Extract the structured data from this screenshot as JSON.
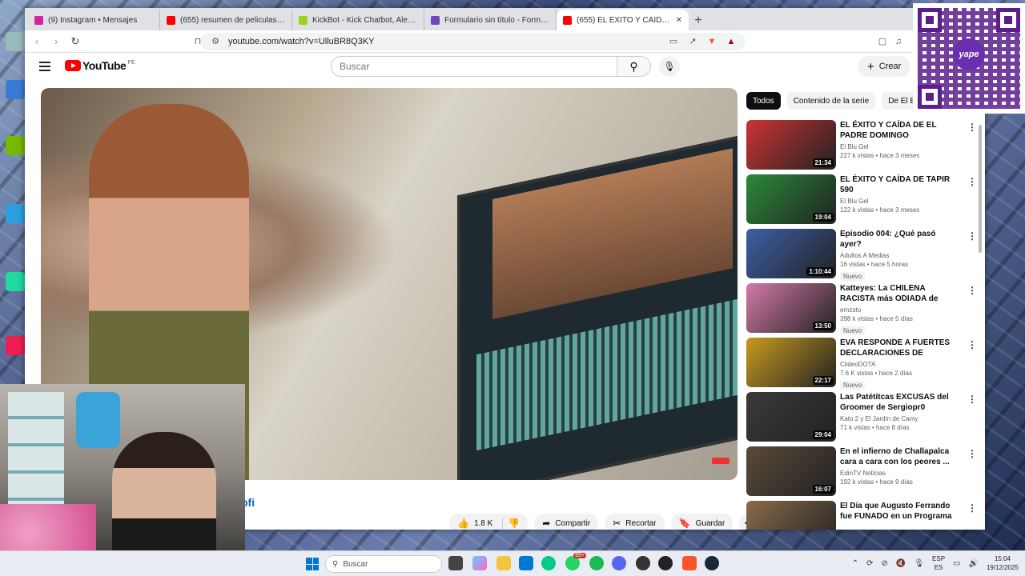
{
  "browser": {
    "tabs": [
      {
        "title": "(9) Instagram • Mensajes",
        "color": "#d6249f"
      },
      {
        "title": "(655) resumen de peliculas - YouTube",
        "color": "#ff0000"
      },
      {
        "title": "KickBot - Kick Chatbot, Alerts, TTS, O...",
        "color": "#9ad317"
      },
      {
        "title": "Formulario sin título - Formularios de...",
        "color": "#7248b9"
      },
      {
        "title": "(655) EL ÉXITO Y CAÍDA DE D...",
        "color": "#ff0000"
      }
    ],
    "url": "youtube.com/watch?v=UlluBR8Q3KY"
  },
  "youtube": {
    "logo_text": "YouTube",
    "country_code": "PE",
    "search_placeholder": "Buscar",
    "create_label": "Crear",
    "title_tail": "ofi",
    "actions": {
      "likes": "1.8 K",
      "share": "Compartir",
      "clip": "Recortar",
      "save": "Guardar"
    },
    "chips": [
      "Todos",
      "Contenido de la serie",
      "De El Blu G"
    ],
    "related": [
      {
        "title": "EL ÉXITO Y CAÍDA DE EL PADRE DOMINGO",
        "channel": "El Blu Gel",
        "meta": "227 k vistas • hace 3 meses",
        "duration": "21:34",
        "badge": ""
      },
      {
        "title": "EL ÉXITO Y CAÍDA DE TAPIR 590",
        "channel": "El Blu Gel",
        "meta": "122 k vistas • hace 3 meses",
        "duration": "19:04",
        "badge": ""
      },
      {
        "title": "Episodio 004: ¿Qué pasó ayer?",
        "channel": "Adultos A Medias",
        "meta": "16 vistas • hace 5 horas",
        "duration": "1:10:44",
        "badge": "Nuevo"
      },
      {
        "title": "Katteyes: La CHILENA RACISTA más ODIADA de TIKTOK",
        "channel": "ernzsto",
        "meta": "398 k vistas • hace 5 días",
        "duration": "13:50",
        "badge": "Nuevo"
      },
      {
        "title": "EVA RESPONDE A FUERTES DECLARACIONES DE KINGTEK...",
        "channel": "ClideoDOTA",
        "meta": "7.6 K vistas • hace 2 días",
        "duration": "22:17",
        "badge": "Nuevo"
      },
      {
        "title": "Las Patétitcas EXCUSAS del Groomer de Sergiopr0",
        "channel": "Kato 2 y El Jardín de Camy",
        "meta": "71 k vistas • hace 8 días",
        "duration": "29:04",
        "badge": ""
      },
      {
        "title": "En el infierno de Challapalca cara a cara con los peores ...",
        "channel": "EdinTV Noticias",
        "meta": "192 k vistas • hace 9 días",
        "duration": "16:07",
        "badge": ""
      },
      {
        "title": "El Día que Augusto Ferrando fue FUNADO en un Programa EN ...",
        "channel": "",
        "meta": "",
        "duration": "",
        "badge": ""
      }
    ]
  },
  "qr": {
    "brand": "yape"
  },
  "taskbar": {
    "search_placeholder": "Buscar",
    "badge_whatsapp": "99+",
    "lang_top": "ESP",
    "lang_bottom": "ES",
    "time": "15:04",
    "date": "19/12/2025"
  }
}
